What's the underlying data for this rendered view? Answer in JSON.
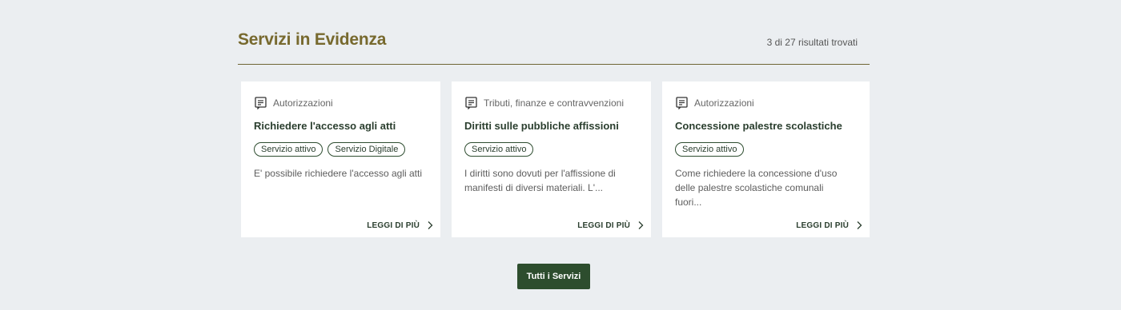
{
  "section": {
    "title": "Servizi in Evidenza",
    "results": "3 di 27 risultati trovati"
  },
  "cards": [
    {
      "category": "Autorizzazioni",
      "title": "Richiedere l'accesso agli atti",
      "chips": [
        "Servizio attivo",
        "Servizio Digitale"
      ],
      "description": "E' possibile richiedere l'accesso agli atti",
      "read_more": "LEGGI DI PIÙ"
    },
    {
      "category": "Tributi, finanze e contravvenzioni",
      "title": "Diritti sulle pubbliche affissioni",
      "chips": [
        "Servizio attivo"
      ],
      "description": "I diritti sono dovuti per l'affissione di manifesti di diversi materiali. L'...",
      "read_more": "LEGGI DI PIÙ"
    },
    {
      "category": "Autorizzazioni",
      "title": "Concessione palestre scolastiche",
      "chips": [
        "Servizio attivo"
      ],
      "description": "Come richiedere la concessione d'uso delle palestre scolastiche comunali fuori...",
      "read_more": "LEGGI DI PIÙ"
    }
  ],
  "all_services_button": "Tutti i Servizi",
  "icons": {
    "category": "document-icon",
    "read_more": "chevron-right-icon"
  },
  "colors": {
    "background": "#ebeef1",
    "title": "#77692e",
    "primary": "#2d4d2e",
    "divider": "#6f6534"
  }
}
